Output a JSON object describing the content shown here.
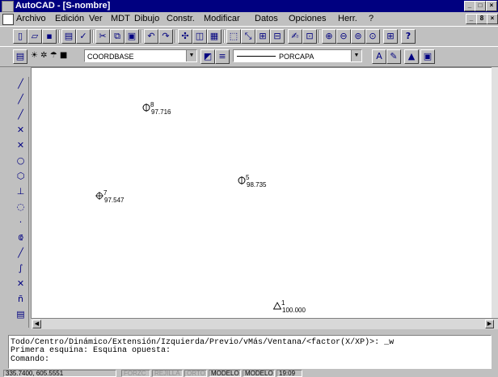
{
  "window": {
    "title": "AutoCAD - [S-nombre]",
    "buttons": [
      "_",
      "□",
      "×"
    ]
  },
  "menubar": {
    "items": [
      "Archivo",
      "Edición",
      "Ver",
      "MDT",
      "Dibujo",
      "Constr.",
      "Modificar",
      "Datos",
      "Opciones",
      "Herr.",
      "?"
    ],
    "doc_buttons": [
      "_",
      "8",
      "×"
    ]
  },
  "toolbar": {
    "standard_icons": [
      "new-icon",
      "open-icon",
      "save-icon",
      "print-icon",
      "spell-icon",
      "cut-icon",
      "copy-icon",
      "paste-icon",
      "undo-icon",
      "redo-icon",
      "snap-icon",
      "zoom-window-icon",
      "zoom-previous-icon",
      "redraw-icon",
      "pan-icon",
      "list-icon",
      "distance-icon",
      "area-icon",
      "zoom-in-icon",
      "zoom-out-icon",
      "zoom-all-icon",
      "zoom-extents-icon",
      "aerial-view-icon",
      "help-icon"
    ]
  },
  "objprops": {
    "layer": "COORDBASE",
    "linetype": "PORCAPA",
    "icons": [
      "layer-state-icon",
      "color-icon",
      "linetype-icon",
      "text-icon",
      "edit-text-icon",
      "hatch-icon",
      "properties-icon"
    ]
  },
  "draw_tools": [
    "line-icon",
    "xline-icon",
    "polyline-icon",
    "multiline-icon",
    "arc-icon",
    "circle-icon",
    "polygon-icon",
    "dimension-icon",
    "ellipse-icon",
    "point-icon",
    "block-icon",
    "spline-icon",
    "region-icon",
    "erase-icon",
    "text-tool-icon",
    "hatch-tool-icon"
  ],
  "drawing": {
    "points": [
      {
        "number": "8",
        "value": "97.716",
        "marker": "circle"
      },
      {
        "number": "7",
        "value": "97.547",
        "marker": "crosshair"
      },
      {
        "number": "5",
        "value": "98.735",
        "marker": "circle"
      },
      {
        "number": "1",
        "value": "100.000",
        "marker": "triangle"
      }
    ]
  },
  "command": {
    "lines": [
      "Todo/Centro/Dinámico/Extensión/Izquierda/Previo/vMás/Ventana/<factor(X/XP)>: _w",
      "Primera esquina: Esquina opuesta:",
      "Comando:"
    ]
  },
  "status": {
    "coords": "335.7400, 605.5551",
    "toggles": [
      {
        "label": "FORZC",
        "on": false
      },
      {
        "label": "REJILLA",
        "on": false
      },
      {
        "label": "ORTO",
        "on": false
      },
      {
        "label": "MODELO",
        "on": true
      },
      {
        "label": "MODELO",
        "on": true
      },
      {
        "label": "19:09",
        "on": true
      }
    ]
  }
}
